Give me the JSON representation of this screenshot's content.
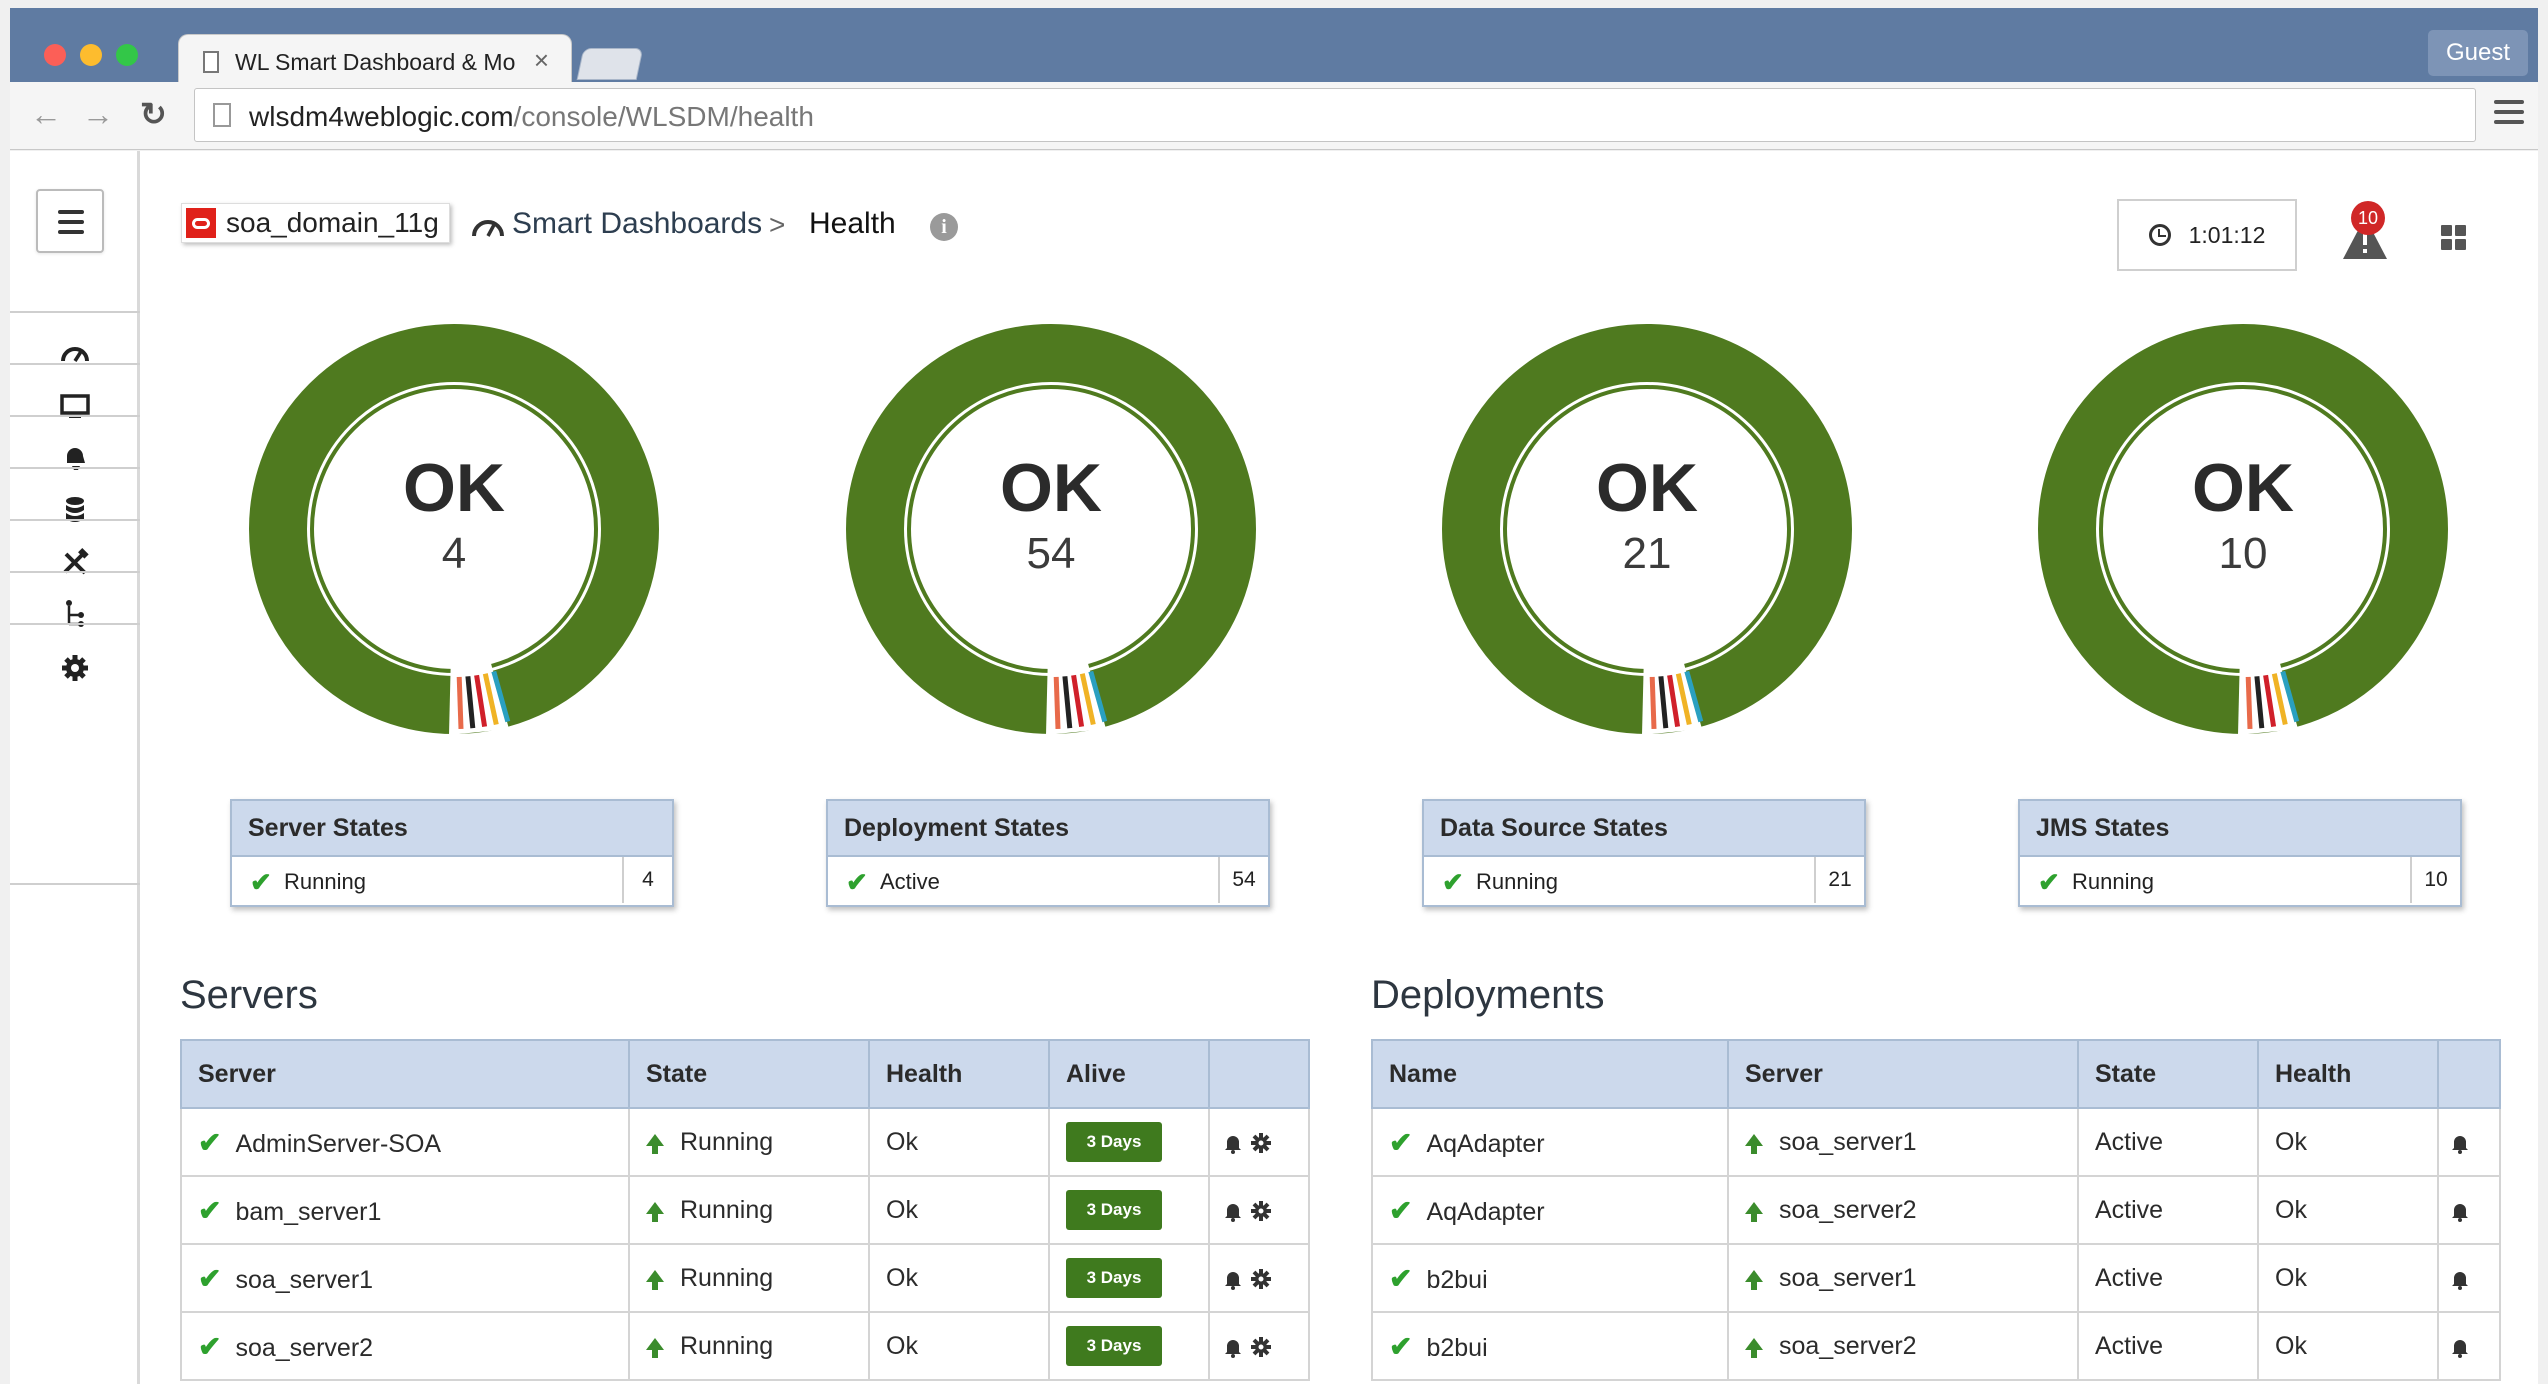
{
  "browser": {
    "tab_title": "WL Smart Dashboard & Mo",
    "tab_close": "×",
    "guest_label": "Guest",
    "url_host": "wlsdm4weblogic.com",
    "url_path": "/console/WLSDM/health"
  },
  "header": {
    "domain_name": "soa_domain_11g",
    "breadcrumb_parent": "Smart Dashboards",
    "breadcrumb_separator": ">",
    "breadcrumb_current": "Health",
    "info": "i",
    "timer": "1:01:12",
    "alert_count": "10"
  },
  "sidebar": {
    "items": [
      {
        "icon": "speedometer-icon"
      },
      {
        "icon": "monitor-icon"
      },
      {
        "icon": "notification-icon"
      },
      {
        "icon": "database-icon"
      },
      {
        "icon": "tools-icon"
      },
      {
        "icon": "tree-icon"
      },
      {
        "icon": "gear-icon"
      }
    ]
  },
  "gauges": [
    {
      "status": "OK",
      "count": "4"
    },
    {
      "status": "OK",
      "count": "54"
    },
    {
      "status": "OK",
      "count": "21"
    },
    {
      "status": "OK",
      "count": "10"
    }
  ],
  "state_cards": [
    {
      "title": "Server States",
      "label": "Running",
      "count": "4"
    },
    {
      "title": "Deployment States",
      "label": "Active",
      "count": "54"
    },
    {
      "title": "Data Source States",
      "label": "Running",
      "count": "21"
    },
    {
      "title": "JMS States",
      "label": "Running",
      "count": "10"
    }
  ],
  "servers": {
    "title": "Servers",
    "columns": [
      "Server",
      "State",
      "Health",
      "Alive",
      ""
    ],
    "rows": [
      {
        "server": "AdminServer-SOA",
        "state": "Running",
        "health": "Ok",
        "alive": "3 Days"
      },
      {
        "server": "bam_server1",
        "state": "Running",
        "health": "Ok",
        "alive": "3 Days"
      },
      {
        "server": "soa_server1",
        "state": "Running",
        "health": "Ok",
        "alive": "3 Days"
      },
      {
        "server": "soa_server2",
        "state": "Running",
        "health": "Ok",
        "alive": "3 Days"
      }
    ]
  },
  "deployments": {
    "title": "Deployments",
    "columns": [
      "Name",
      "Server",
      "State",
      "Health",
      ""
    ],
    "rows": [
      {
        "name": "AqAdapter",
        "server": "soa_server1",
        "state": "Active",
        "health": "Ok"
      },
      {
        "name": "AqAdapter",
        "server": "soa_server2",
        "state": "Active",
        "health": "Ok"
      },
      {
        "name": "b2bui",
        "server": "soa_server1",
        "state": "Active",
        "health": "Ok"
      },
      {
        "name": "b2bui",
        "server": "soa_server2",
        "state": "Active",
        "health": "Ok"
      }
    ]
  },
  "colors": {
    "ok_green": "#4f7a1f",
    "header_blue": "#ccd9ec",
    "alert_red": "#d02727",
    "stripes": [
      "#e86a4a",
      "#222222",
      "#d0202a",
      "#f0b325",
      "#2aa0c0"
    ]
  }
}
